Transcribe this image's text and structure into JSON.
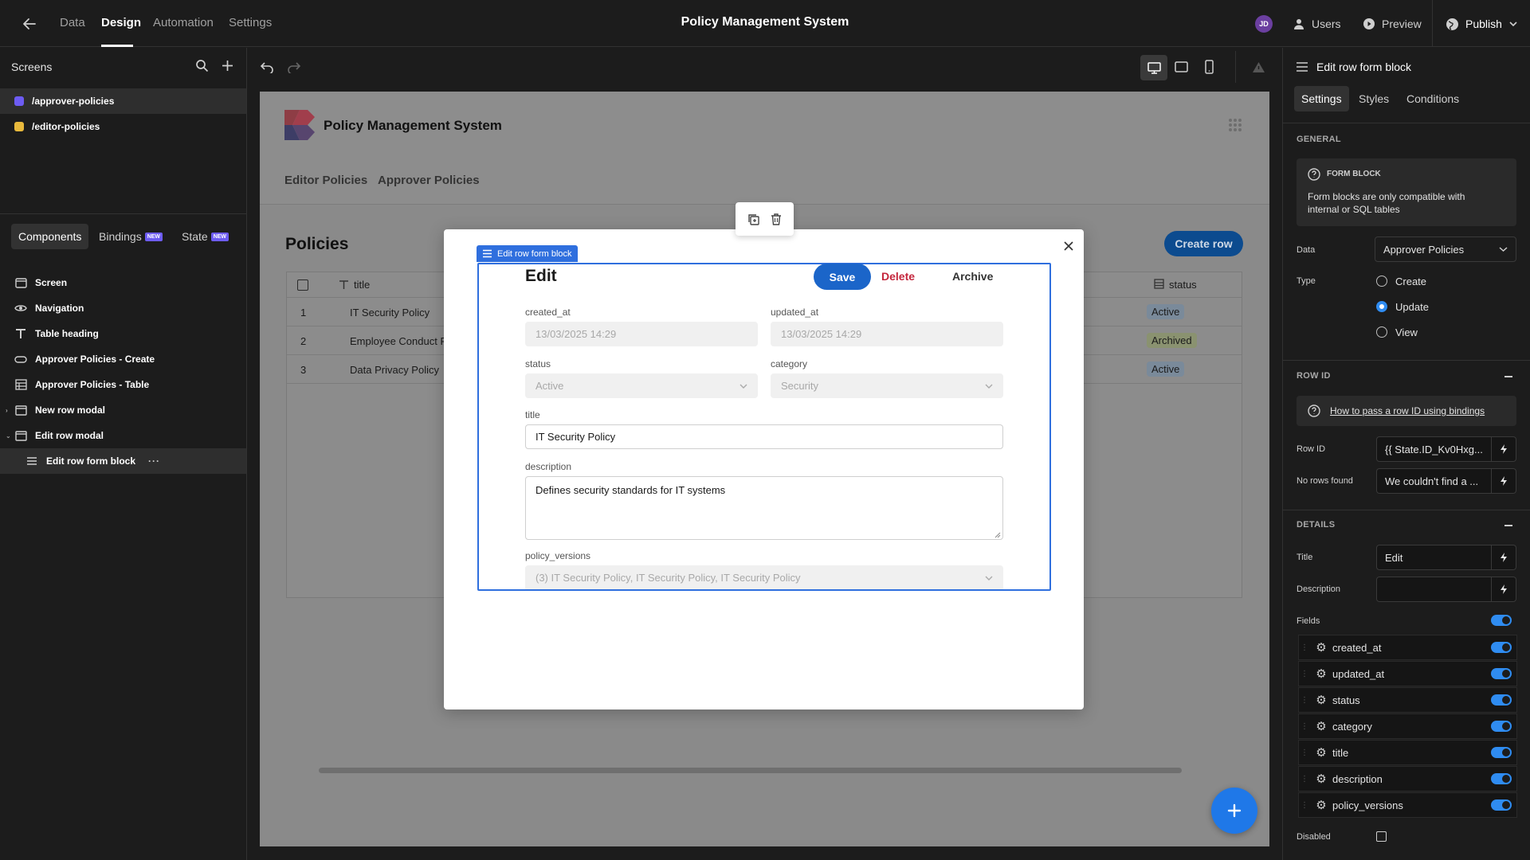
{
  "topbar": {
    "tabs": [
      "Data",
      "Design",
      "Automation",
      "Settings"
    ],
    "app_title": "Policy Management System",
    "avatar_initials": "JD",
    "users_label": "Users",
    "preview_label": "Preview",
    "publish_label": "Publish"
  },
  "screens": {
    "header": "Screens",
    "items": [
      {
        "path": "/approver-policies",
        "color": "#6d5cf3"
      },
      {
        "path": "/editor-policies",
        "color": "#e8b93c"
      }
    ]
  },
  "left_tabs": {
    "components": "Components",
    "bindings": "Bindings",
    "state": "State",
    "new_badge": "NEW"
  },
  "components": [
    {
      "label": "Screen",
      "icon": "screen-icon"
    },
    {
      "label": "Navigation",
      "icon": "eye-icon"
    },
    {
      "label": "Table heading",
      "icon": "text-icon"
    },
    {
      "label": "Approver Policies - Create",
      "icon": "button-icon"
    },
    {
      "label": "Approver Policies - Table",
      "icon": "table-icon"
    },
    {
      "label": "New row modal",
      "icon": "modal-icon"
    },
    {
      "label": "Edit row modal",
      "icon": "modal-icon"
    },
    {
      "label": "Edit row form block",
      "icon": "form-icon"
    }
  ],
  "preview": {
    "app_title": "Policy Management System",
    "nav": [
      "Editor Policies",
      "Approver Policies"
    ],
    "heading": "Policies",
    "create_row": "Create row",
    "table": {
      "title_col": "title",
      "status_col": "status",
      "rows": [
        {
          "num": "1",
          "title": "IT Security Policy",
          "status": "Active"
        },
        {
          "num": "2",
          "title": "Employee Conduct P",
          "status": "Archived"
        },
        {
          "num": "3",
          "title": "Data Privacy Policy",
          "status": "Active"
        }
      ]
    }
  },
  "form": {
    "block_label": "Edit row form block",
    "title": "Edit",
    "save": "Save",
    "delete": "Delete",
    "archive": "Archive",
    "fields": {
      "created_at": {
        "label": "created_at",
        "value": "13/03/2025 14:29"
      },
      "updated_at": {
        "label": "updated_at",
        "value": "13/03/2025 14:29"
      },
      "status": {
        "label": "status",
        "value": "Active"
      },
      "category": {
        "label": "category",
        "value": "Security"
      },
      "title": {
        "label": "title",
        "value": "IT Security Policy"
      },
      "description": {
        "label": "description",
        "value": "Defines security standards for IT systems"
      },
      "policy_versions": {
        "label": "policy_versions",
        "value": "(3) IT Security Policy, IT Security Policy, IT Security Policy"
      }
    }
  },
  "right_panel": {
    "title": "Edit row form block",
    "tabs": [
      "Settings",
      "Styles",
      "Conditions"
    ],
    "general_section": "GENERAL",
    "info_title": "FORM BLOCK",
    "info_text": "Form blocks are only compatible with internal or SQL tables",
    "data_label": "Data",
    "data_value": "Approver Policies",
    "type_label": "Type",
    "type_options": [
      "Create",
      "Update",
      "View"
    ],
    "type_selected": "Update",
    "rowid_section": "ROW ID",
    "rowid_link": "How to pass a row ID using bindings",
    "rowid_label": "Row ID",
    "rowid_value": "{{ State.ID_Kv0Hxg...",
    "norows_label": "No rows found",
    "norows_value": "We couldn't find a ...",
    "details_section": "DETAILS",
    "title_label": "Title",
    "title_value": "Edit",
    "description_label": "Description",
    "description_value": "",
    "fields_label": "Fields",
    "fields": [
      "created_at",
      "updated_at",
      "status",
      "category",
      "title",
      "description",
      "policy_versions"
    ],
    "disabled_label": "Disabled"
  }
}
